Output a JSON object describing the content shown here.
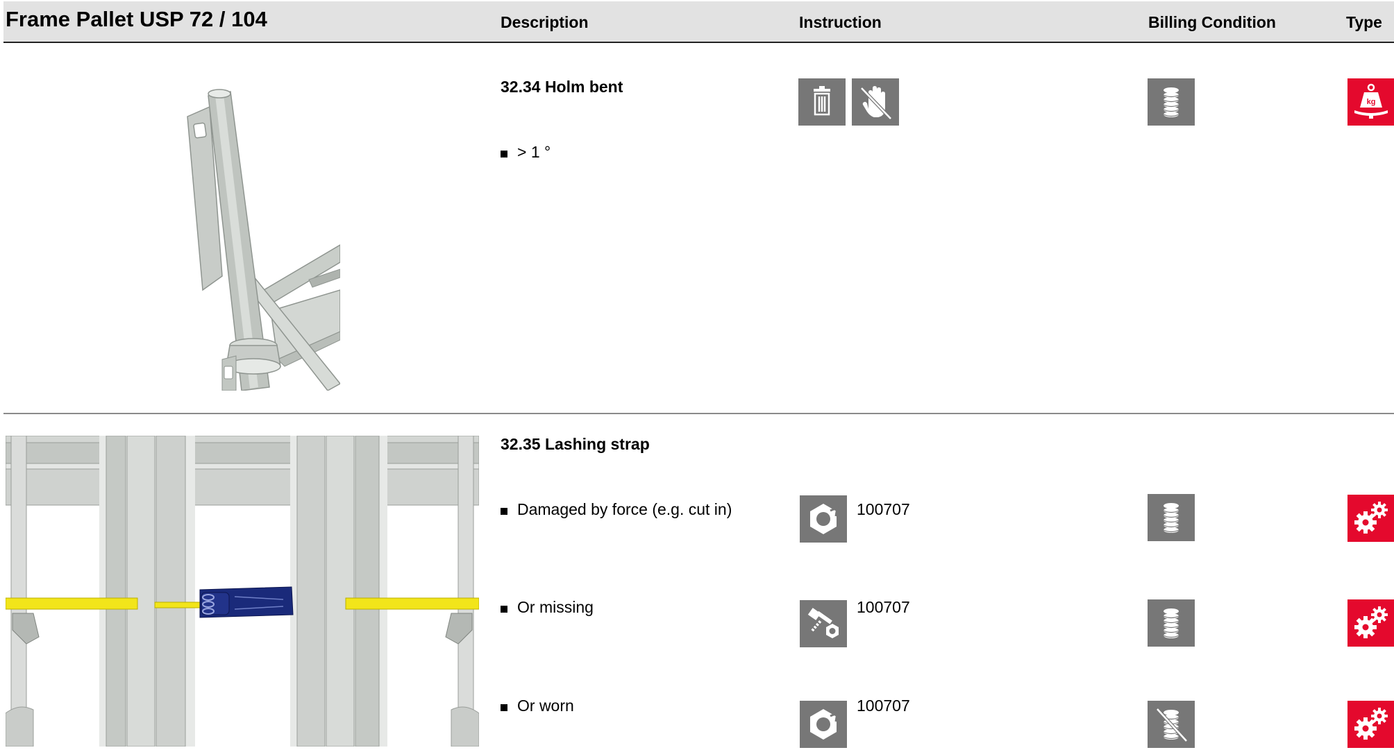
{
  "header": {
    "title": "Frame Pallet USP 72 / 104",
    "col_description": "Description",
    "col_instruction": "Instruction",
    "col_billing": "Billing Condition",
    "col_type": "Type"
  },
  "sections": [
    {
      "title": "32.34 Holm bent",
      "rows": [
        {
          "text": "> 1 °",
          "instruction_icons": [
            "trash-scrap-icon",
            "do-not-touch-hand-icon"
          ],
          "code": "",
          "billing_icon": "coin-stack-icon",
          "type_icon": "weight-kg-icon"
        }
      ]
    },
    {
      "title": "32.35 Lashing strap",
      "rows": [
        {
          "text": "Damaged by force (e.g. cut in)",
          "instruction_icons": [
            "nut-replace-icon"
          ],
          "code": "100707",
          "billing_icon": "coin-stack-icon",
          "type_icon": "gears-repair-icon"
        },
        {
          "text": "Or missing",
          "instruction_icons": [
            "bolt-and-nut-icon"
          ],
          "code": "100707",
          "billing_icon": "coin-stack-icon",
          "type_icon": "gears-repair-icon"
        },
        {
          "text": "Or worn",
          "instruction_icons": [
            "nut-replace-icon"
          ],
          "code": "100707",
          "billing_icon": "coin-stack-crossed-icon",
          "type_icon": "gears-repair-icon"
        }
      ]
    }
  ],
  "colors": {
    "header_bg": "#e2e2e2",
    "icon_gray": "#777777",
    "icon_red": "#e4092d",
    "strap_yellow": "#f2e51a",
    "buckle_blue": "#1a2a7a"
  }
}
